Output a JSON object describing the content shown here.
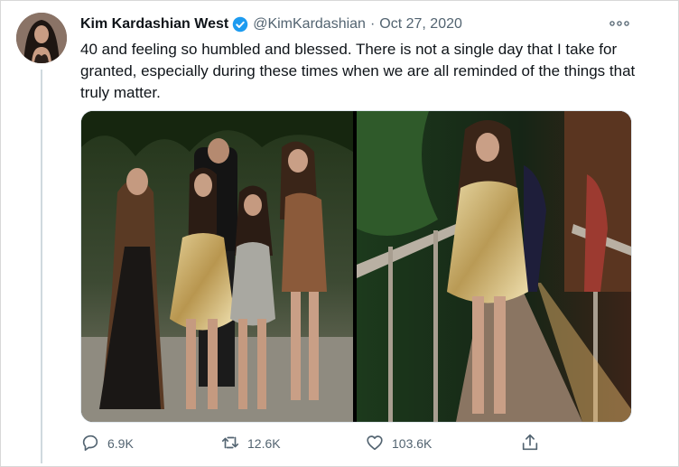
{
  "tweet": {
    "author_name": "Kim Kardashian West",
    "handle": "@KimKardashian",
    "separator": "·",
    "date": "Oct 27, 2020",
    "text": "40 and feeling so humbled and blessed. There is not a single day that I take for granted, especially during these times when we are all reminded of the things that truly matter."
  },
  "actions": {
    "replies": "6.9K",
    "retweets": "12.6K",
    "likes": "103.6K"
  },
  "icons": {
    "verified": "verified-badge-icon",
    "more": "more-options-icon",
    "reply": "reply-icon",
    "retweet": "retweet-icon",
    "like": "like-icon",
    "share": "share-icon"
  },
  "colors": {
    "verified": "#1d9bf0",
    "secondary_text": "#536471",
    "thread_line": "#cfd9de"
  }
}
